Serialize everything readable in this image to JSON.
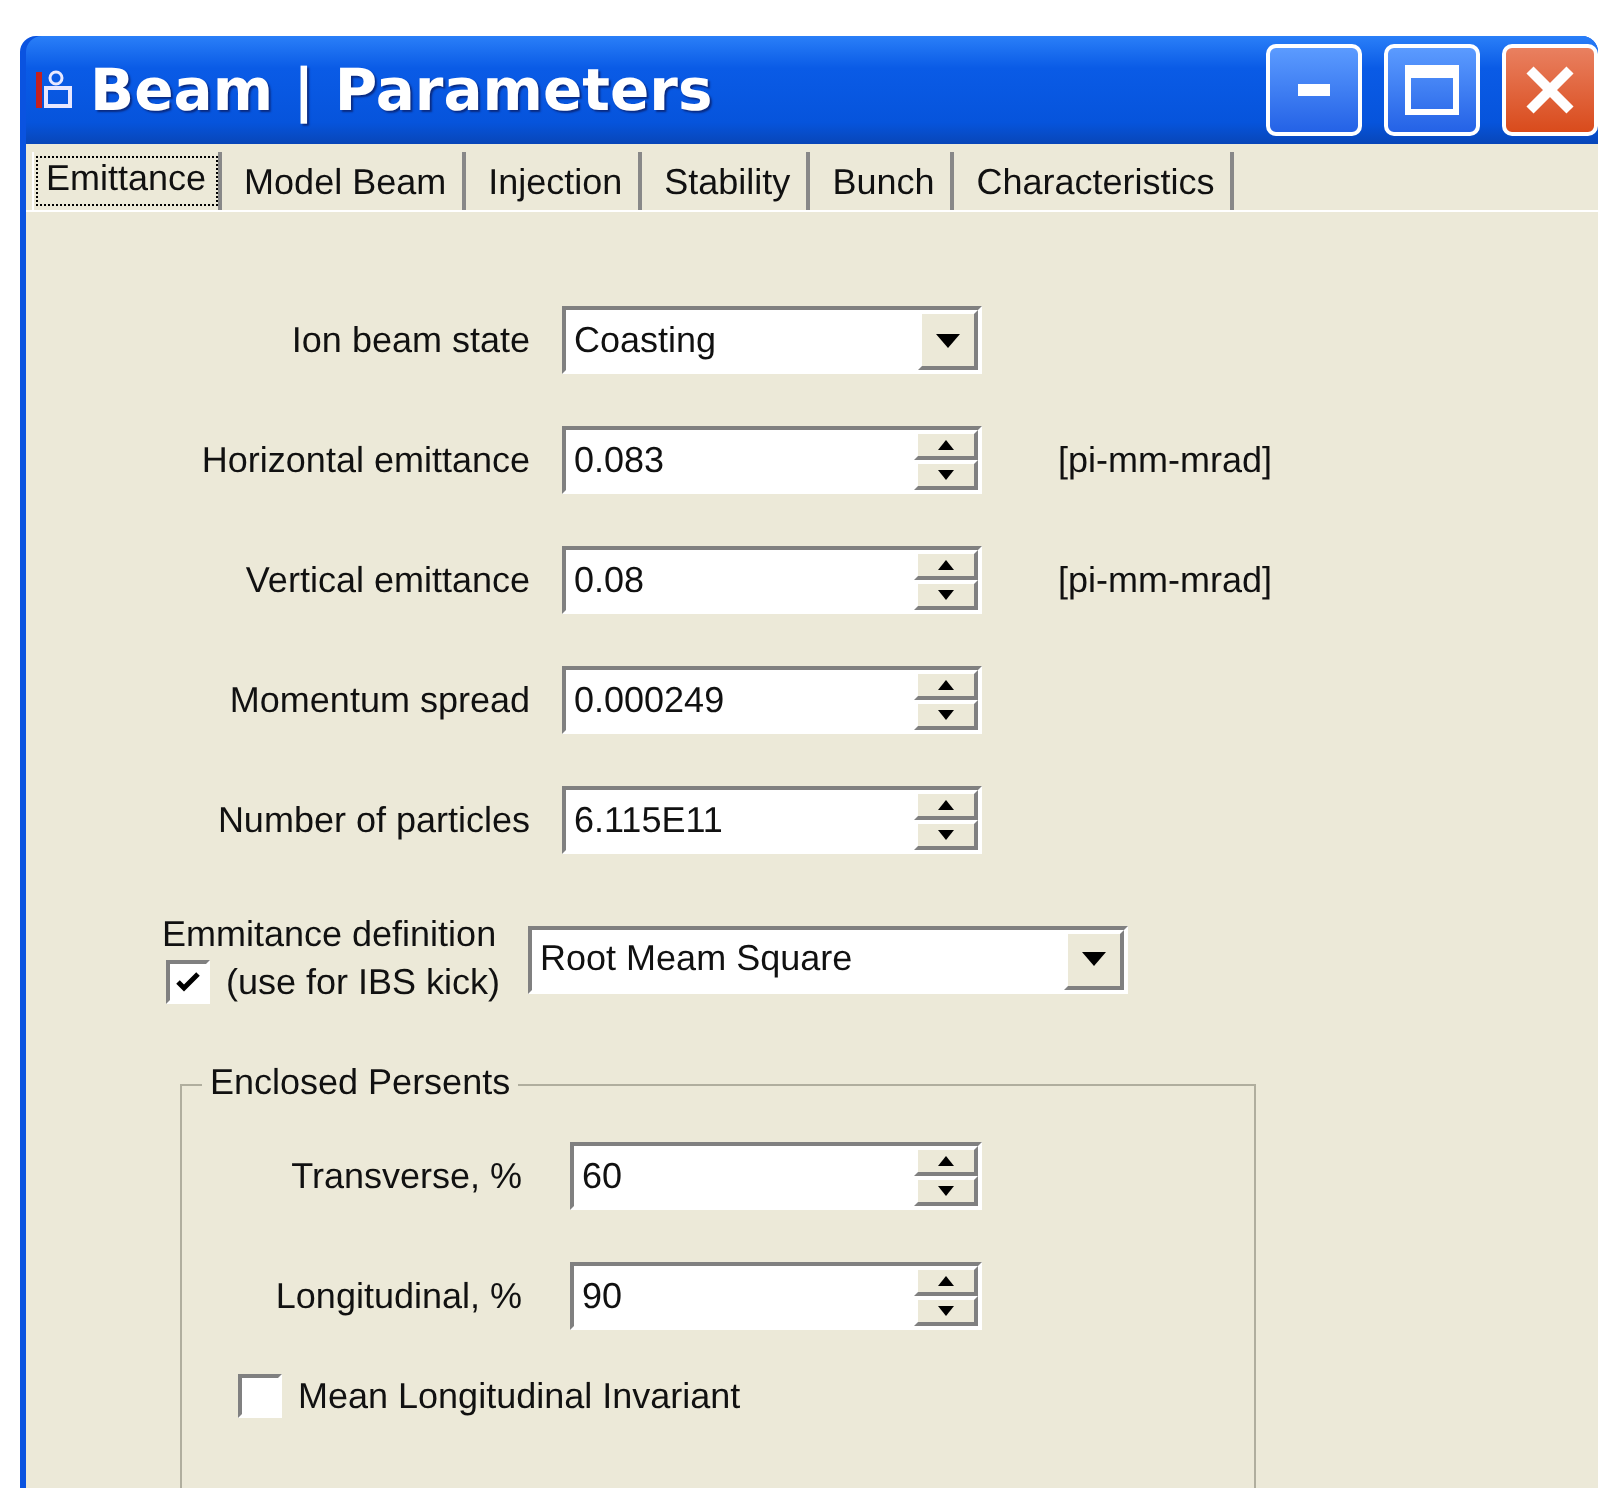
{
  "window": {
    "title": "Beam | Parameters"
  },
  "tabs": [
    {
      "label": "Emittance",
      "selected": true
    },
    {
      "label": "Model Beam",
      "selected": false
    },
    {
      "label": "Injection",
      "selected": false
    },
    {
      "label": "Stability",
      "selected": false
    },
    {
      "label": "Bunch",
      "selected": false
    },
    {
      "label": "Characteristics",
      "selected": false
    }
  ],
  "fields": [
    {
      "kind": "dropdown",
      "label": "Ion beam state",
      "value": "Coasting"
    },
    {
      "kind": "spin",
      "label": "Horizontal emittance",
      "value": "0.083",
      "unit": "[pi-mm-mrad]"
    },
    {
      "kind": "spin",
      "label": "Vertical emittance",
      "value": "0.08",
      "unit": "[pi-mm-mrad]"
    },
    {
      "kind": "spin",
      "label": "Momentum spread",
      "value": "0.000249"
    },
    {
      "kind": "spin",
      "label": "Number of particles",
      "value": "6.115E11"
    }
  ],
  "emittance_definition": {
    "label": "Emmitance definition",
    "checkbox_label": "(use for IBS kick)",
    "checked": true,
    "value": "Root Meam Square"
  },
  "enclosed_percents": {
    "title": "Enclosed Persents",
    "fields": [
      {
        "label": "Transverse, %",
        "value": "60"
      },
      {
        "label": "Longitudinal, %",
        "value": "90"
      }
    ],
    "checkbox": {
      "label": "Mean Longitudinal Invariant",
      "checked": false
    }
  }
}
